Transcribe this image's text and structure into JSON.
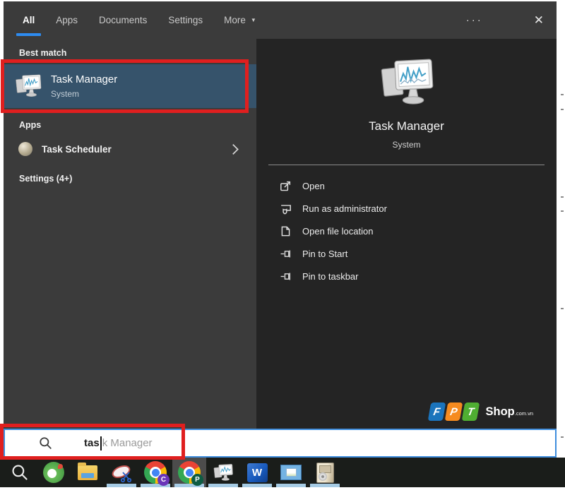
{
  "tabbar": {
    "tabs": [
      {
        "label": "All",
        "active": true
      },
      {
        "label": "Apps",
        "active": false
      },
      {
        "label": "Documents",
        "active": false
      },
      {
        "label": "Settings",
        "active": false
      },
      {
        "label": "More",
        "active": false
      }
    ],
    "more_caret": "▼",
    "ellipsis": "···",
    "close": "✕"
  },
  "results": {
    "best_match_header": "Best match",
    "best_match": {
      "title": "Task Manager",
      "subtitle": "System",
      "icon": "task-manager-icon"
    },
    "apps_header": "Apps",
    "apps": [
      {
        "label": "Task Scheduler",
        "icon": "task-scheduler-icon"
      }
    ],
    "settings_header": "Settings (4+)"
  },
  "preview": {
    "icon": "task-manager-icon",
    "title": "Task Manager",
    "subtitle": "System",
    "actions": [
      {
        "label": "Open",
        "icon": "open-icon"
      },
      {
        "label": "Run as administrator",
        "icon": "run-as-administrator-icon"
      },
      {
        "label": "Open file location",
        "icon": "open-file-location-icon"
      },
      {
        "label": "Pin to Start",
        "icon": "pin-icon"
      },
      {
        "label": "Pin to taskbar",
        "icon": "pin-icon"
      }
    ],
    "watermark": {
      "letters": [
        {
          "char": "F",
          "color": "#1b74bc"
        },
        {
          "char": "P",
          "color": "#f68b1f"
        },
        {
          "char": "T",
          "color": "#4fae32"
        }
      ],
      "shop": "Shop",
      "domain": ".com.vn"
    }
  },
  "searchbox": {
    "icon": "search-icon",
    "typed": "tas",
    "suggestion": "k Manager"
  },
  "taskbar": {
    "icons": [
      {
        "name": "search-icon",
        "running": false
      },
      {
        "name": "coccoc-browser-icon",
        "running": false
      },
      {
        "name": "file-explorer-icon",
        "running": false
      },
      {
        "name": "snipping-tool-icon",
        "running": true
      },
      {
        "name": "chrome-profile-icon",
        "badge": "C",
        "running": true
      },
      {
        "name": "chrome-profile-icon",
        "badge": "P",
        "running": true,
        "active": true
      },
      {
        "name": "task-manager-icon",
        "running": true
      },
      {
        "name": "word-icon",
        "letter": "W",
        "running": true
      },
      {
        "name": "photo-viewer-icon",
        "running": true
      },
      {
        "name": "installer-icon",
        "running": true
      }
    ]
  },
  "annotations": {
    "highlight_color": "#e01f1f"
  }
}
